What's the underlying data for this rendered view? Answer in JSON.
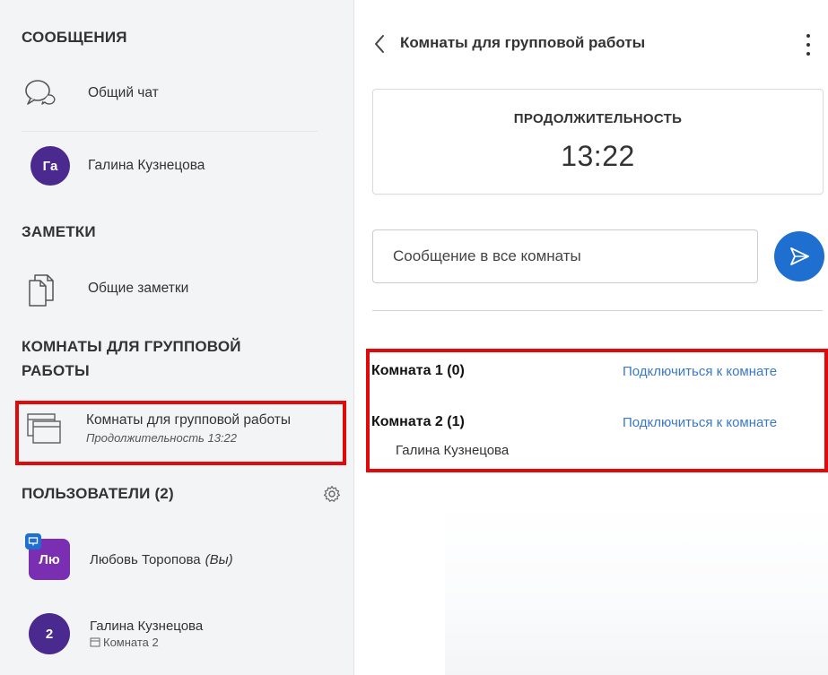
{
  "sidebar": {
    "messages": {
      "title": "СООБЩЕНИЯ",
      "public_chat": "Общий чат",
      "private_chat_user": "Галина Кузнецова",
      "private_chat_initials": "Га"
    },
    "notes": {
      "title": "ЗАМЕТКИ",
      "shared_notes": "Общие заметки"
    },
    "breakout": {
      "title_line1": "КОМНАТЫ ДЛЯ ГРУППОВОЙ",
      "title_line2": "РАБОТЫ",
      "item_label": "Комнаты для групповой работы",
      "item_sub": "Продолжительность 13:22"
    },
    "users": {
      "title": "ПОЛЬЗОВАТЕЛИ (2)",
      "list": [
        {
          "initials": "Лю",
          "name": "Любовь Торопова",
          "suffix": "(Вы)"
        },
        {
          "initials": "2",
          "name": "Галина Кузнецова",
          "room": "Комната 2"
        }
      ]
    }
  },
  "main": {
    "title": "Комнаты для групповой работы",
    "duration_label": "ПРОДОЛЖИТЕЛЬНОСТЬ",
    "duration_value": "13:22",
    "message_placeholder": "Сообщение в все комнаты",
    "rooms": [
      {
        "name": "Комната 1 (0)",
        "join": "Подключиться к комнате",
        "members": []
      },
      {
        "name": "Комната 2 (1)",
        "join": "Подключиться к комнате",
        "members": [
          "Галина Кузнецова"
        ]
      }
    ]
  },
  "colors": {
    "highlight": "#e10a0a",
    "accent": "#1f6fd1",
    "link": "#3a78c9",
    "avatar": "#4b2a8f"
  }
}
